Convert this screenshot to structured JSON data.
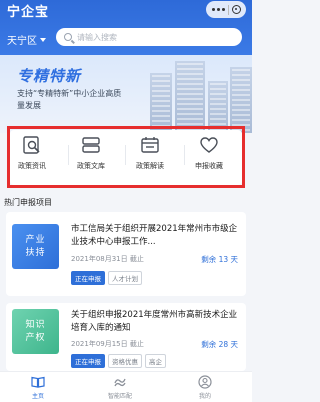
{
  "app": {
    "title": "宁企宝"
  },
  "header": {
    "district": "天宁区",
    "search_placeholder": "请输入搜索"
  },
  "banner": {
    "title": "专精特新",
    "subtitle": "支持“专精特新”中小企业高质量发展"
  },
  "quick_links": [
    {
      "label": "政策资讯",
      "icon": "policy-news-icon"
    },
    {
      "label": "政策文库",
      "icon": "policy-library-icon"
    },
    {
      "label": "政策解读",
      "icon": "policy-interpretation-icon"
    },
    {
      "label": "申报收藏",
      "icon": "heart-icon"
    }
  ],
  "section": {
    "title": "热门申报项目"
  },
  "projects": [
    {
      "thumb_line1": "产业",
      "thumb_line2": "扶持",
      "title": "市工信局关于组织开展2021年常州市市级企业技术中心申报工作...",
      "date": "2021年08月31日",
      "deadline": "截止",
      "remaining": "剩余 13 天",
      "tags": [
        "正在申报",
        "人才计划"
      ]
    },
    {
      "thumb_line1": "知识",
      "thumb_line2": "产权",
      "title": "关于组织申报2021年度常州市高新技术企业培育入库的通知",
      "date": "2021年09月15日",
      "deadline": "截止",
      "remaining": "剩余 28 天",
      "tags": [
        "正在申报",
        "资格优惠",
        "高企"
      ]
    }
  ],
  "tabbar": [
    {
      "label": "主页",
      "icon": "book-icon"
    },
    {
      "label": "智能匹配",
      "icon": "match-icon"
    },
    {
      "label": "我的",
      "icon": "user-icon"
    }
  ],
  "colors": {
    "primary": "#2e6fd8",
    "highlight": "#e62e2e"
  }
}
